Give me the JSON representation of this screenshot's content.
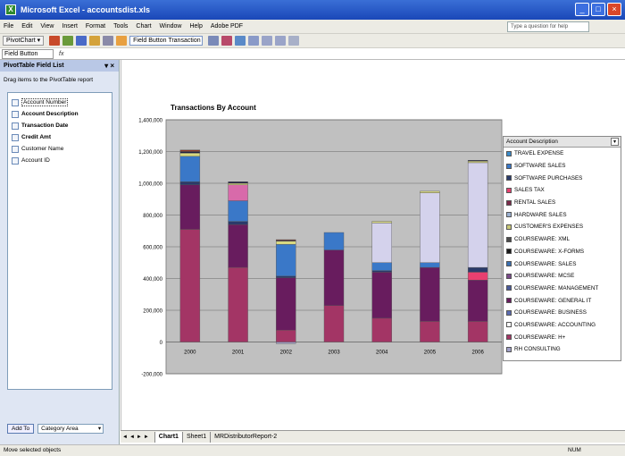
{
  "window": {
    "title": "Microsoft Excel - accountsdist.xls",
    "app_icon": "excel-icon"
  },
  "menu": [
    "File",
    "Edit",
    "View",
    "Insert",
    "Format",
    "Tools",
    "Chart",
    "Window",
    "Help",
    "Adobe PDF"
  ],
  "help_box": {
    "placeholder": "Type a question for help"
  },
  "toolbar": {
    "pivot_label": "PivotChart ▾",
    "field_selector": "Field Button  Transaction ▾"
  },
  "formula_bar": {
    "name_box": "Field Button",
    "fx": "fx"
  },
  "field_list": {
    "title": "PivotTable Field List",
    "instruction": "Drag items to the PivotTable report",
    "fields": [
      {
        "label": "Account Number",
        "bold": false
      },
      {
        "label": "Account Description",
        "bold": true
      },
      {
        "label": "Transaction Date",
        "bold": true
      },
      {
        "label": "Credit Amt",
        "bold": true
      },
      {
        "label": "Customer Name",
        "bold": false
      },
      {
        "label": "Account ID",
        "bold": false
      }
    ],
    "add_to_label": "Add To",
    "area": "Category Area"
  },
  "chart_data": {
    "type": "bar",
    "stacked": true,
    "title": "Transactions By Account",
    "categories": [
      "2000",
      "2001",
      "2002",
      "2003",
      "2004",
      "2005",
      "2006"
    ],
    "ylim": [
      -200000,
      1400000
    ],
    "y_ticks": [
      "1,400,000",
      "1,200,000",
      "1,000,000",
      "800,000",
      "600,000",
      "400,000",
      "200,000",
      "0",
      "-200,000"
    ],
    "grid": true,
    "legend_position": "right",
    "legend_title": "Account Description",
    "series": [
      {
        "name": "RH CONSULTING",
        "color": "#a0a0c8",
        "values": [
          0,
          0,
          -10000,
          0,
          0,
          0,
          0
        ]
      },
      {
        "name": "COURSEWARE: H+",
        "color": "#a33565",
        "values": [
          710000,
          470000,
          75000,
          230000,
          150000,
          130000,
          130000
        ]
      },
      {
        "name": "COURSEWARE: ACCOUNTING",
        "color": "#ffffff",
        "values": [
          0,
          0,
          0,
          0,
          0,
          0,
          0
        ]
      },
      {
        "name": "COURSEWARE: BUSINESS",
        "color": "#5a6ab0",
        "values": [
          0,
          0,
          0,
          0,
          0,
          0,
          0
        ]
      },
      {
        "name": "COURSEWARE: GENERAL IT",
        "color": "#681c5e",
        "values": [
          280000,
          270000,
          330000,
          350000,
          290000,
          340000,
          260000
        ]
      },
      {
        "name": "COURSEWARE: MANAGEMENT",
        "color": "#4a5a9a",
        "values": [
          0,
          0,
          0,
          0,
          0,
          0,
          0
        ]
      },
      {
        "name": "COURSEWARE: MCSE",
        "color": "#7a4a8a",
        "values": [
          0,
          0,
          0,
          0,
          0,
          0,
          0
        ]
      },
      {
        "name": "COURSEWARE: SALES",
        "color": "#3a6fb0",
        "values": [
          0,
          0,
          0,
          0,
          0,
          0,
          0
        ]
      },
      {
        "name": "COURSEWARE: X-FORMS",
        "color": "#1a1a1a",
        "values": [
          0,
          0,
          0,
          0,
          0,
          0,
          0
        ]
      },
      {
        "name": "COURSEWARE: XML",
        "color": "#6a6a6a",
        "values": [
          0,
          0,
          0,
          0,
          0,
          0,
          0
        ]
      },
      {
        "name": "CUSTOMER'S EXPENSES",
        "color": "#c8c878",
        "values": [
          0,
          0,
          0,
          0,
          0,
          0,
          0
        ]
      },
      {
        "name": "HARDWARE SALES",
        "color": "#9ab0d0",
        "values": [
          0,
          0,
          0,
          0,
          0,
          0,
          0
        ]
      },
      {
        "name": "RENTAL SALES",
        "color": "#7a2a4a",
        "values": [
          0,
          0,
          0,
          0,
          0,
          0,
          0
        ]
      },
      {
        "name": "SALES TAX",
        "color": "#e84070",
        "values": [
          0,
          0,
          0,
          0,
          0,
          0,
          50000
        ]
      },
      {
        "name": "SOFTWARE PURCHASES",
        "color": "#2a3a6a",
        "values": [
          20000,
          20000,
          10000,
          0,
          10000,
          0,
          30000
        ]
      },
      {
        "name": "SOFTWARE SALES",
        "color": "#3a78c8",
        "values": [
          160000,
          130000,
          200000,
          110000,
          50000,
          30000,
          0
        ]
      },
      {
        "name": "TRAVEL EXPENSE",
        "color": "#d4d2ec",
        "values": [
          0,
          0,
          0,
          0,
          250000,
          440000,
          660000
        ]
      },
      {
        "name": "HARDWARE SALES",
        "color": "#d86aaa",
        "values": [
          0,
          100000,
          0,
          0,
          0,
          0,
          0
        ]
      },
      {
        "name": "CUSTOMER'S EXPENSES",
        "color": "#d8d880",
        "values": [
          20000,
          10000,
          20000,
          0,
          10000,
          10000,
          10000
        ]
      },
      {
        "name": "SOFTWARE PURCHASES",
        "color": "#222244",
        "values": [
          10000,
          10000,
          5000,
          0,
          0,
          0,
          5000
        ]
      },
      {
        "name": "RENTAL SALES",
        "color": "#8a3a2a",
        "values": [
          10000,
          0,
          5000,
          0,
          0,
          0,
          0
        ]
      }
    ]
  },
  "legend_items": [
    {
      "label": "TRAVEL EXPENSE",
      "color": "#3a8ac8"
    },
    {
      "label": "SOFTWARE SALES",
      "color": "#3a78c8"
    },
    {
      "label": "SOFTWARE PURCHASES",
      "color": "#2a3a6a"
    },
    {
      "label": "SALES TAX",
      "color": "#e84070"
    },
    {
      "label": "RENTAL SALES",
      "color": "#7a2a4a"
    },
    {
      "label": "HARDWARE SALES",
      "color": "#9ab0d0"
    },
    {
      "label": "CUSTOMER'S EXPENSES",
      "color": "#c8c878"
    },
    {
      "label": "COURSEWARE: XML",
      "color": "#4a4a4a"
    },
    {
      "label": "COURSEWARE: X-FORMS",
      "color": "#1a1a1a"
    },
    {
      "label": "COURSEWARE: SALES",
      "color": "#3a6fb0"
    },
    {
      "label": "COURSEWARE: MCSE",
      "color": "#7a4a8a"
    },
    {
      "label": "COURSEWARE: MANAGEMENT",
      "color": "#4a5a9a"
    },
    {
      "label": "COURSEWARE: GENERAL IT",
      "color": "#681c5e"
    },
    {
      "label": "COURSEWARE: BUSINESS",
      "color": "#5a6ab0"
    },
    {
      "label": "COURSEWARE: ACCOUNTING",
      "color": "#ffffff"
    },
    {
      "label": "COURSEWARE: H+",
      "color": "#a33565"
    },
    {
      "label": "RH CONSULTING",
      "color": "#a0a0c8"
    }
  ],
  "sheet_tabs": [
    "Chart1",
    "Sheet1",
    "MRDistributorReport-2"
  ],
  "status": {
    "left": "Move selected objects",
    "right": "NUM"
  }
}
